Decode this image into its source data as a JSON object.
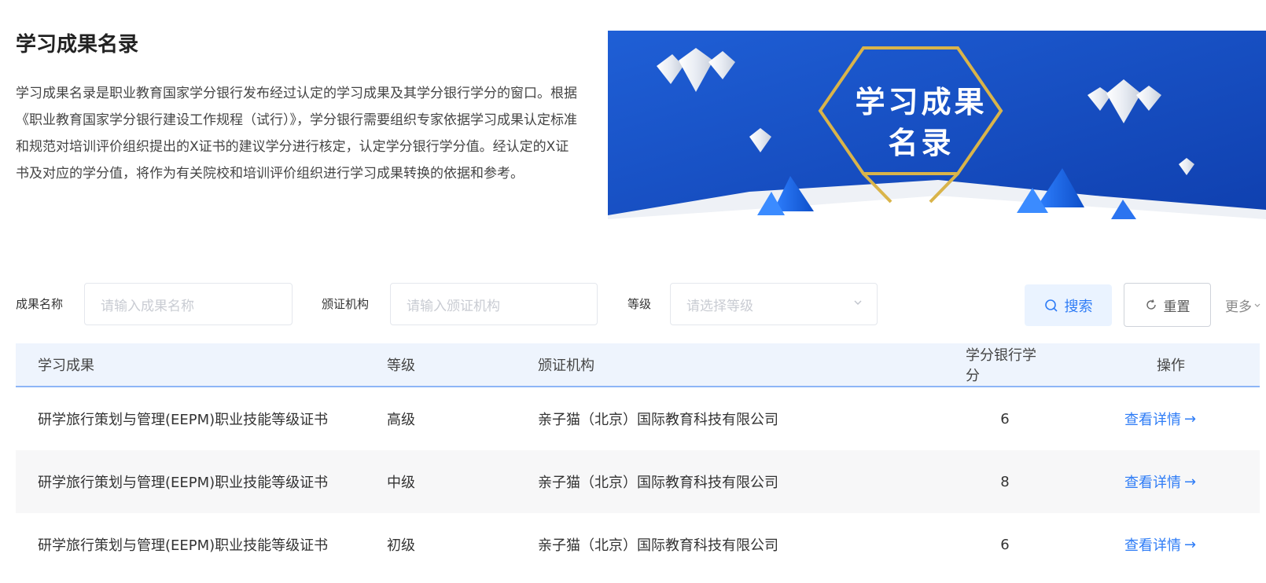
{
  "page": {
    "title": "学习成果名录",
    "intro": "学习成果名录是职业教育国家学分银行发布经过认定的学习成果及其学分银行学分的窗口。根据《职业教育国家学分银行建设工作规程（试行）》，学分银行需要组织专家依据学习成果认定标准和规范对培训评价组织提出的X证书的建议学分进行核定，认定学分银行学分值。经认定的X证书及对应的学分值，将作为有关院校和培训评价组织进行学习成果转换的依据和参考。"
  },
  "banner": {
    "line1": "学习成果",
    "line2": "名录"
  },
  "filters": {
    "name_label": "成果名称",
    "name_placeholder": "请输入成果名称",
    "org_label": "颁证机构",
    "org_placeholder": "请输入颁证机构",
    "level_label": "等级",
    "level_placeholder": "请选择等级",
    "search_label": "搜索",
    "reset_label": "重置",
    "more_label": "更多"
  },
  "table": {
    "headers": [
      "学习成果",
      "等级",
      "颁证机构",
      "学分银行学分",
      "操作"
    ],
    "rows": [
      {
        "name": "研学旅行策划与管理(EEPM)职业技能等级证书",
        "level": "高级",
        "org": "亲子猫（北京）国际教育科技有限公司",
        "credits": "6",
        "action": "查看详情"
      },
      {
        "name": "研学旅行策划与管理(EEPM)职业技能等级证书",
        "level": "中级",
        "org": "亲子猫（北京）国际教育科技有限公司",
        "credits": "8",
        "action": "查看详情"
      },
      {
        "name": "研学旅行策划与管理(EEPM)职业技能等级证书",
        "level": "初级",
        "org": "亲子猫（北京）国际教育科技有限公司",
        "credits": "6",
        "action": "查看详情"
      }
    ]
  },
  "colors": {
    "accent": "#2e7cf6",
    "banner_blue": "#1a4fc4",
    "banner_gold": "#d9b44a"
  }
}
